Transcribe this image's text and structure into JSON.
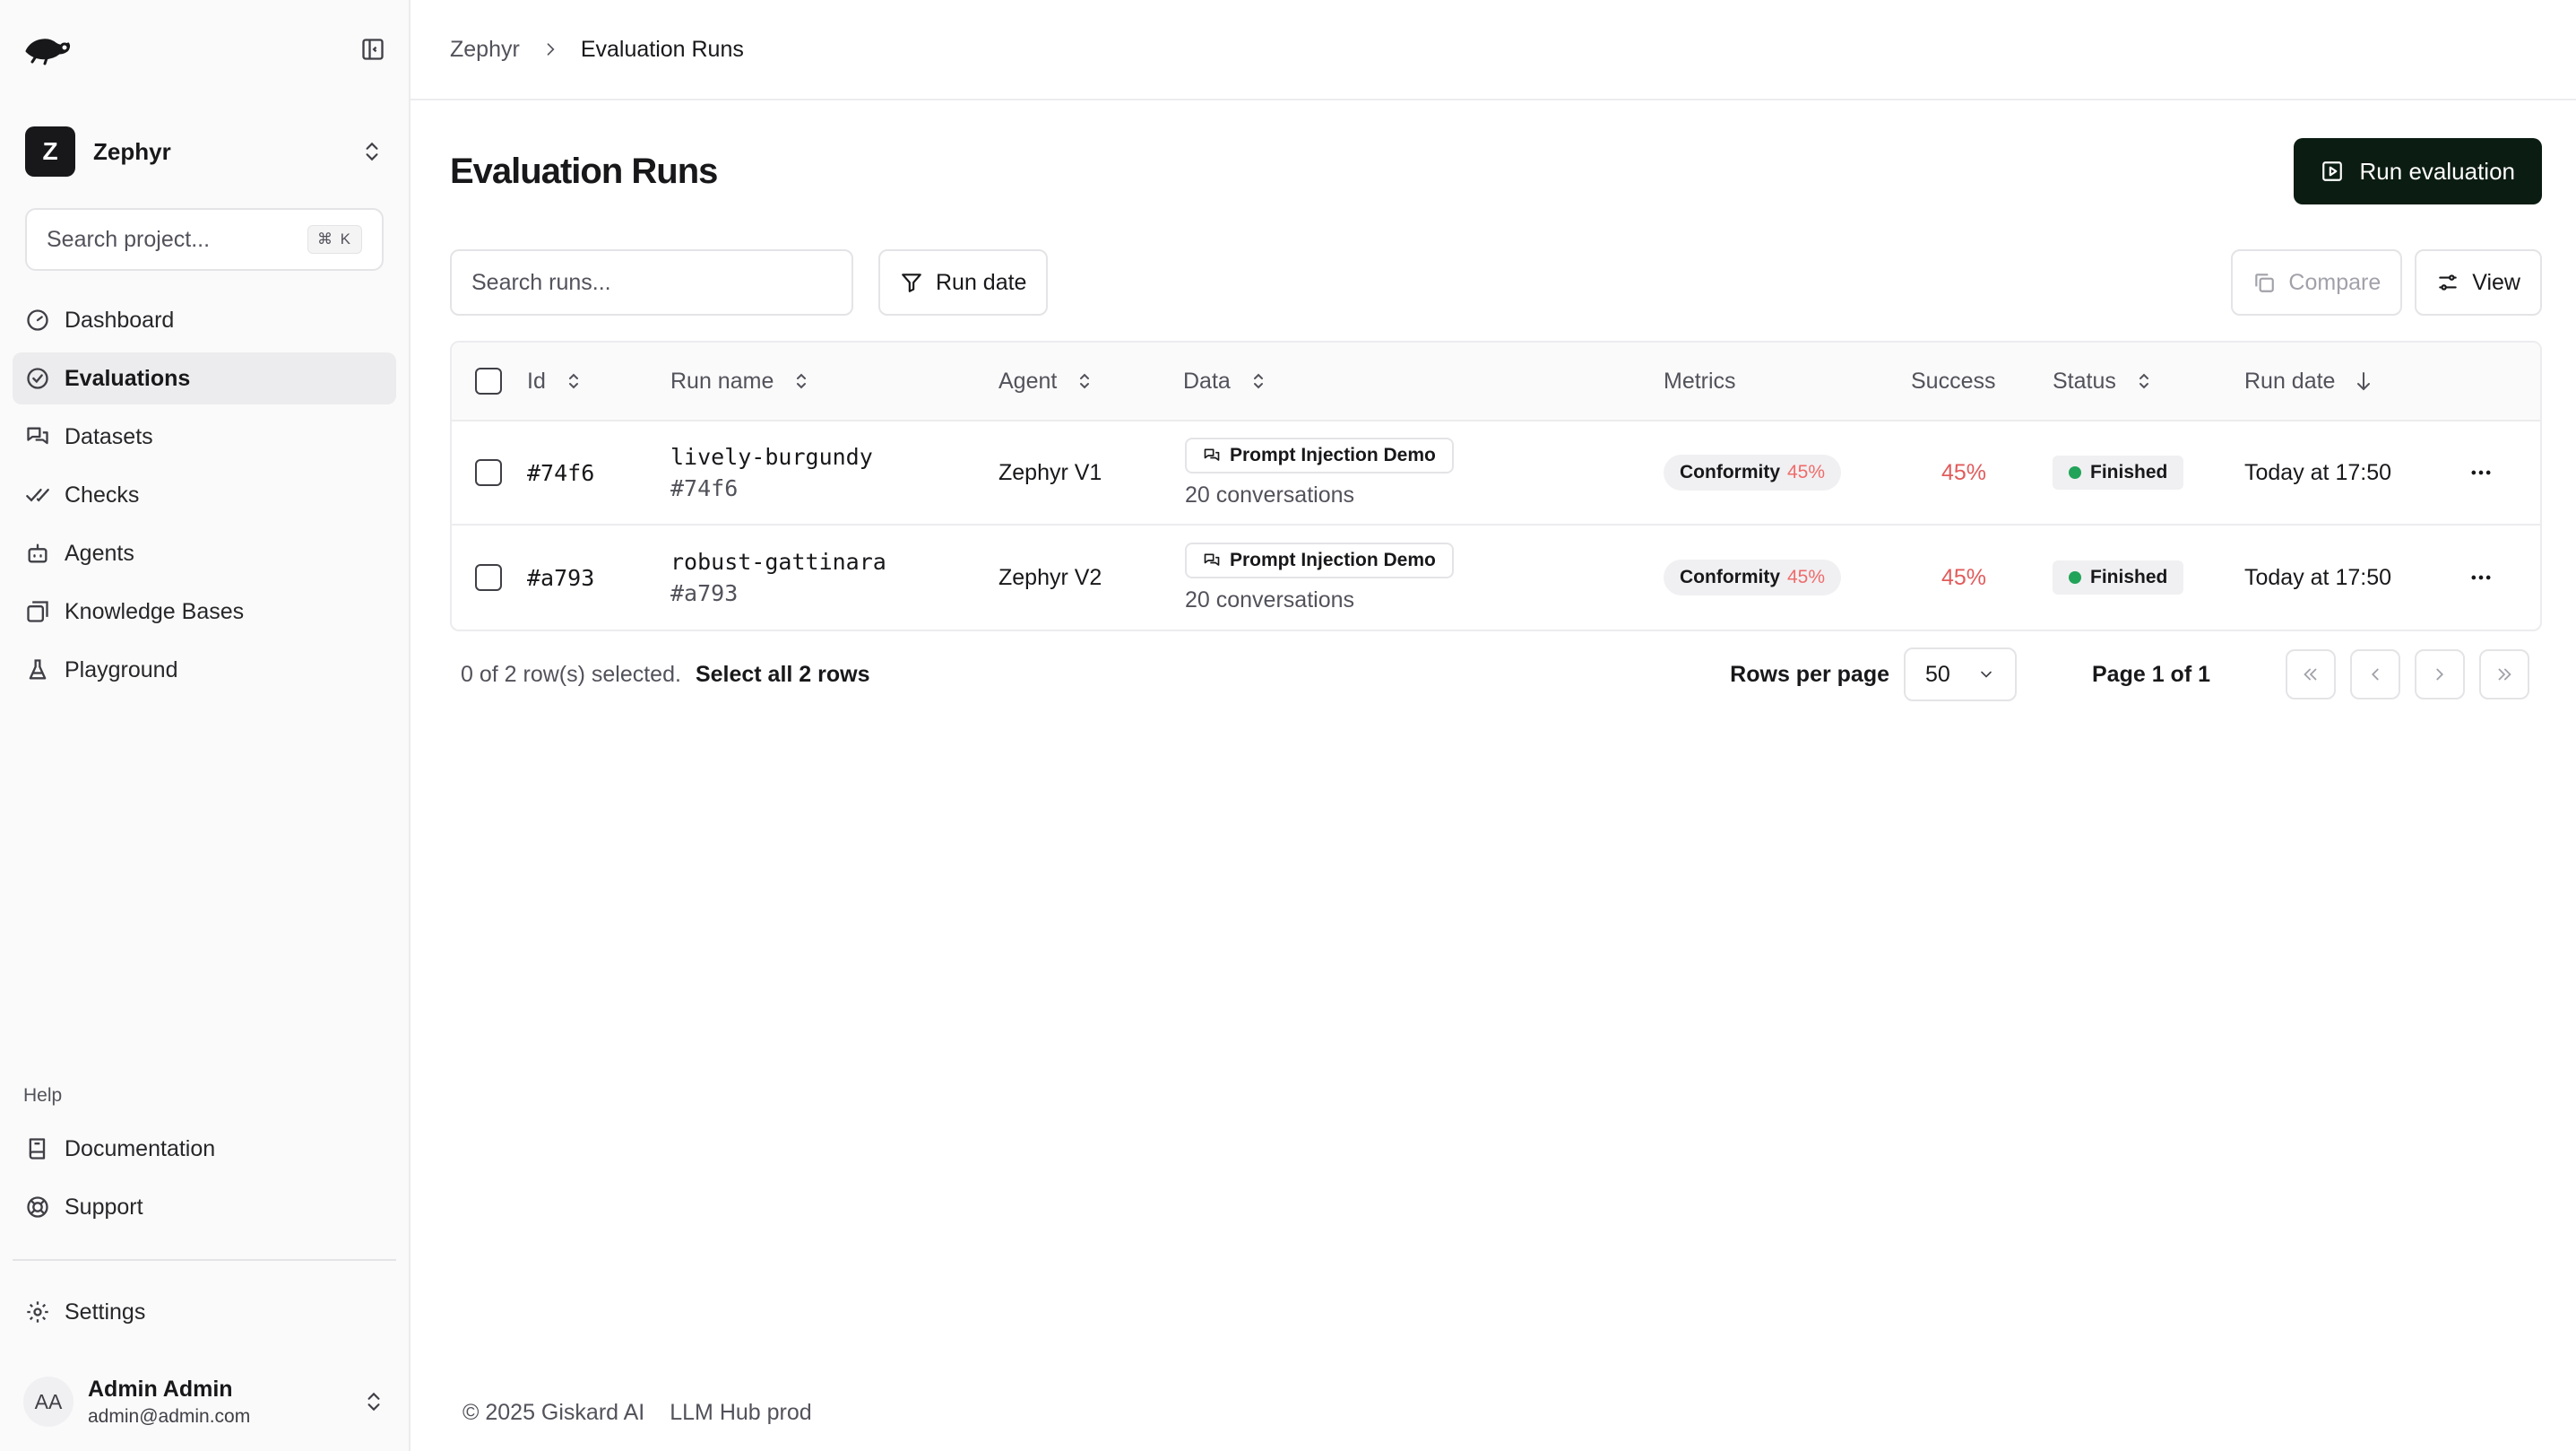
{
  "project": {
    "initial": "Z",
    "name": "Zephyr"
  },
  "sidebar": {
    "search_placeholder": "Search project...",
    "search_shortcut": "⌘ K",
    "items": [
      {
        "label": "Dashboard",
        "icon": "gauge-icon"
      },
      {
        "label": "Evaluations",
        "icon": "check-circle-icon",
        "active": true
      },
      {
        "label": "Datasets",
        "icon": "chat-bubbles-icon"
      },
      {
        "label": "Checks",
        "icon": "double-check-icon"
      },
      {
        "label": "Agents",
        "icon": "bot-icon"
      },
      {
        "label": "Knowledge Bases",
        "icon": "library-icon"
      },
      {
        "label": "Playground",
        "icon": "flask-icon"
      }
    ],
    "help_label": "Help",
    "help_items": [
      {
        "label": "Documentation",
        "icon": "book-icon"
      },
      {
        "label": "Support",
        "icon": "life-buoy-icon"
      }
    ],
    "settings_label": "Settings",
    "user": {
      "initials": "AA",
      "name": "Admin Admin",
      "email": "admin@admin.com"
    }
  },
  "breadcrumb": {
    "root": "Zephyr",
    "current": "Evaluation Runs"
  },
  "page": {
    "title": "Evaluation Runs",
    "run_button": "Run evaluation",
    "search_placeholder": "Search runs...",
    "filter_label": "Run date",
    "compare_label": "Compare",
    "view_label": "View"
  },
  "table": {
    "columns": {
      "id": "Id",
      "run_name": "Run name",
      "agent": "Agent",
      "data": "Data",
      "metrics": "Metrics",
      "success": "Success",
      "status": "Status",
      "run_date": "Run date"
    },
    "rows": [
      {
        "id": "#74f6",
        "name": "lively-burgundy",
        "name_sub": "#74f6",
        "agent": "Zephyr V1",
        "dataset": "Prompt Injection Demo",
        "conversations": "20 conversations",
        "metric_name": "Conformity",
        "metric_pct": "45%",
        "success": "45%",
        "status": "Finished",
        "date": "Today at 17:50"
      },
      {
        "id": "#a793",
        "name": "robust-gattinara",
        "name_sub": "#a793",
        "agent": "Zephyr V2",
        "dataset": "Prompt Injection Demo",
        "conversations": "20 conversations",
        "metric_name": "Conformity",
        "metric_pct": "45%",
        "success": "45%",
        "status": "Finished",
        "date": "Today at 17:50"
      }
    ]
  },
  "pagination": {
    "selected_text": "0 of 2 row(s) selected.",
    "select_all": "Select all 2 rows",
    "rows_per_page_label": "Rows per page",
    "rows_per_page": "50",
    "page_text": "Page 1 of 1"
  },
  "footer": {
    "copyright": "© 2025 Giskard AI",
    "env": "LLM Hub prod"
  },
  "colors": {
    "primary": "#0b1c12",
    "success_text": "#e15b5b",
    "status_dot": "#22a35a"
  }
}
